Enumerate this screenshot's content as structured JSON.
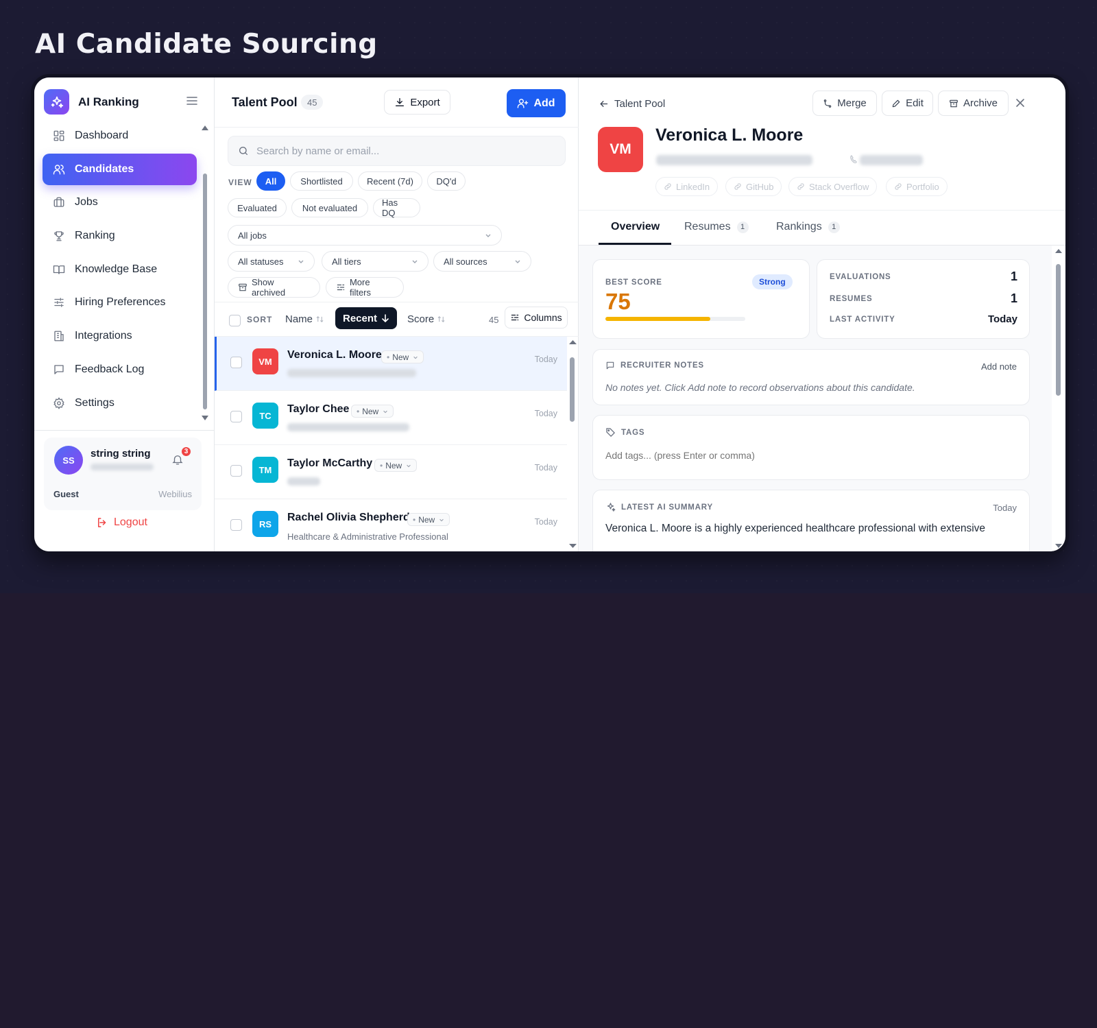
{
  "page_title": "AI Candidate Sourcing",
  "sidebar": {
    "brand": "AI Ranking",
    "items": [
      {
        "label": "Dashboard",
        "icon": "dashboard-icon"
      },
      {
        "label": "Candidates",
        "icon": "users-icon",
        "active": true
      },
      {
        "label": "Jobs",
        "icon": "briefcase-icon"
      },
      {
        "label": "Ranking",
        "icon": "trophy-icon"
      },
      {
        "label": "Knowledge Base",
        "icon": "book-icon"
      },
      {
        "label": "Hiring Preferences",
        "icon": "sliders-icon"
      },
      {
        "label": "Integrations",
        "icon": "building-icon"
      },
      {
        "label": "Feedback Log",
        "icon": "message-icon"
      },
      {
        "label": "Settings",
        "icon": "gear-icon"
      }
    ],
    "user": {
      "initials": "SS",
      "name": "string string",
      "notifications": "3",
      "role": "Guest",
      "org": "Webilius"
    },
    "logout": "Logout"
  },
  "talent_pool": {
    "title": "Talent Pool",
    "count": "45",
    "export_label": "Export",
    "add_label": "Add",
    "search_placeholder": "Search by name or email...",
    "view_label": "VIEW",
    "view_chips": [
      "All",
      "Shortlisted",
      "Recent (7d)",
      "DQ'd",
      "Evaluated",
      "Not evaluated",
      "Has DQ"
    ],
    "active_view": "All",
    "jobs_select": "All jobs",
    "status_select": "All statuses",
    "tier_select": "All tiers",
    "source_select": "All sources",
    "show_archived": "Show archived",
    "more_filters": "More filters",
    "sort_label": "SORT",
    "sort_name": "Name",
    "sort_recent": "Recent",
    "sort_score": "Score",
    "result_count": "45",
    "columns_label": "Columns",
    "candidates": [
      {
        "initials": "VM",
        "name": "Veronica L. Moore",
        "status": "New",
        "date": "Today",
        "subtitle": "",
        "color": "#ef4444"
      },
      {
        "initials": "TC",
        "name": "Taylor Chee",
        "status": "New",
        "date": "Today",
        "subtitle": "",
        "color": "#06b6d4"
      },
      {
        "initials": "TM",
        "name": "Taylor McCarthy",
        "status": "New",
        "date": "Today",
        "subtitle": "",
        "color": "#06b6d4"
      },
      {
        "initials": "RS",
        "name": "Rachel Olivia Shepherd",
        "status": "New",
        "date": "Today",
        "subtitle": "Healthcare & Administrative Professional",
        "color": "#0ea5e9"
      }
    ]
  },
  "detail": {
    "back_label": "Talent Pool",
    "merge_label": "Merge",
    "edit_label": "Edit",
    "archive_label": "Archive",
    "initials": "VM",
    "name": "Veronica L. Moore",
    "links": [
      "LinkedIn",
      "GitHub",
      "Stack Overflow",
      "Portfolio"
    ],
    "tabs": [
      {
        "label": "Overview",
        "count": null
      },
      {
        "label": "Resumes",
        "count": "1"
      },
      {
        "label": "Rankings",
        "count": "1"
      }
    ],
    "best_score_label": "BEST SCORE",
    "best_score": "75",
    "best_score_fraction": 0.75,
    "tier": "Strong",
    "evaluations_label": "EVALUATIONS",
    "evaluations": "1",
    "resumes_label": "RESUMES",
    "resumes": "1",
    "last_activity_label": "LAST ACTIVITY",
    "last_activity": "Today",
    "notes_title": "RECRUITER NOTES",
    "add_note": "Add note",
    "notes_empty": "No notes yet. Click Add note to record observations about this candidate.",
    "tags_title": "TAGS",
    "tags_placeholder": "Add tags... (press Enter or comma)",
    "summary_title": "LATEST AI SUMMARY",
    "summary_date": "Today",
    "summary_text": "Veronica L. Moore is a highly experienced healthcare professional with extensive"
  },
  "colors": {
    "accent": "#1d5ef2",
    "active_gradient_start": "#3f63f2",
    "active_gradient_end": "#8c47ef",
    "score": "#d97706",
    "danger": "#ef4444"
  }
}
